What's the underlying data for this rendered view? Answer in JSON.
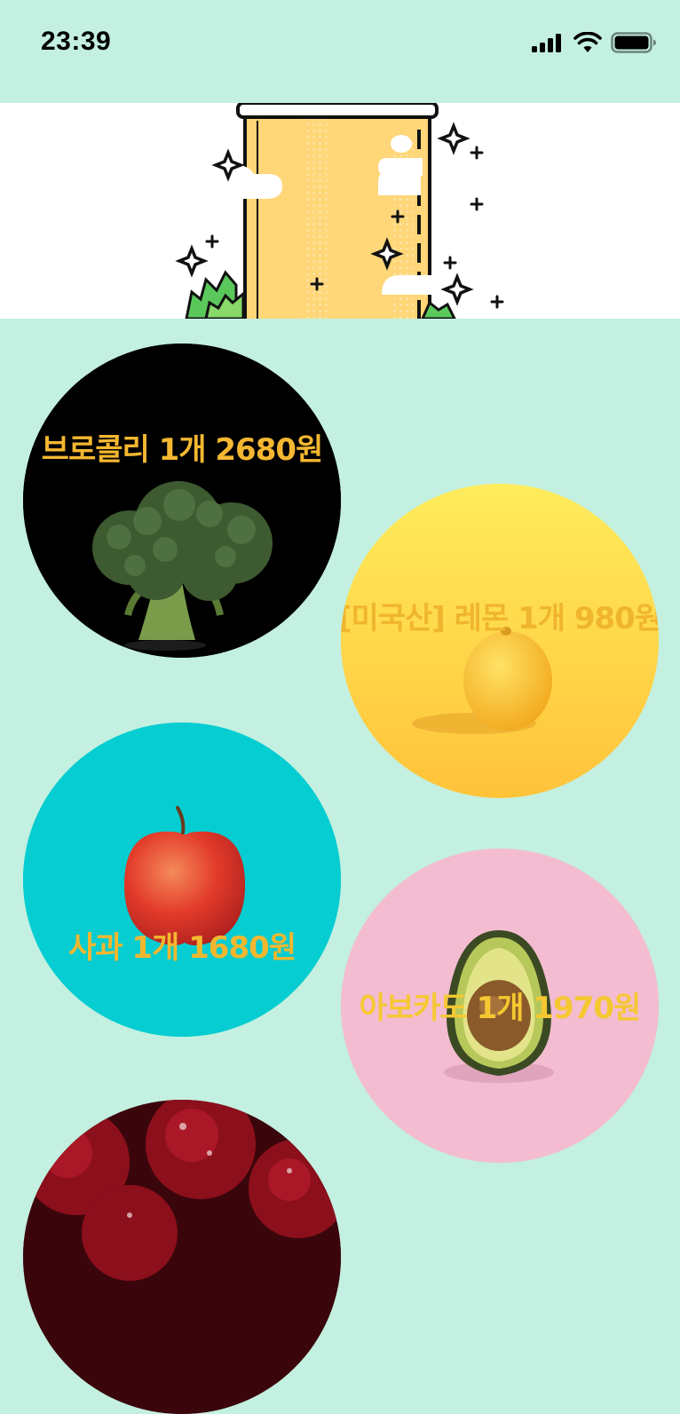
{
  "status_bar": {
    "time": "23:39"
  },
  "banner": {
    "illustration": "juice-glass-with-vegetables-and-sparkles"
  },
  "products": [
    {
      "label": "브로콜리 1개 2680원",
      "image": "broccoli",
      "background": "#000000",
      "label_color": "#f5b731"
    },
    {
      "label": "[미국산] 레몬 1개 980원",
      "image": "lemon",
      "background": "#ffd84a",
      "label_color": "#f0b52e"
    },
    {
      "label": "사과 1개 1680원",
      "image": "apple",
      "background": "#00cdd0",
      "label_color": "#f2b72f"
    },
    {
      "label": "아보카도 1개 1970원",
      "image": "avocado",
      "background": "#f2bad0",
      "label_color": "#f5c831"
    },
    {
      "label": "",
      "image": "cherries",
      "background": "#5a0d14",
      "label_color": "#f2b72f"
    }
  ],
  "colors": {
    "app_background": "#c3f0e0",
    "banner_background": "#ffffff",
    "accent_yellow": "#ffd66e"
  }
}
